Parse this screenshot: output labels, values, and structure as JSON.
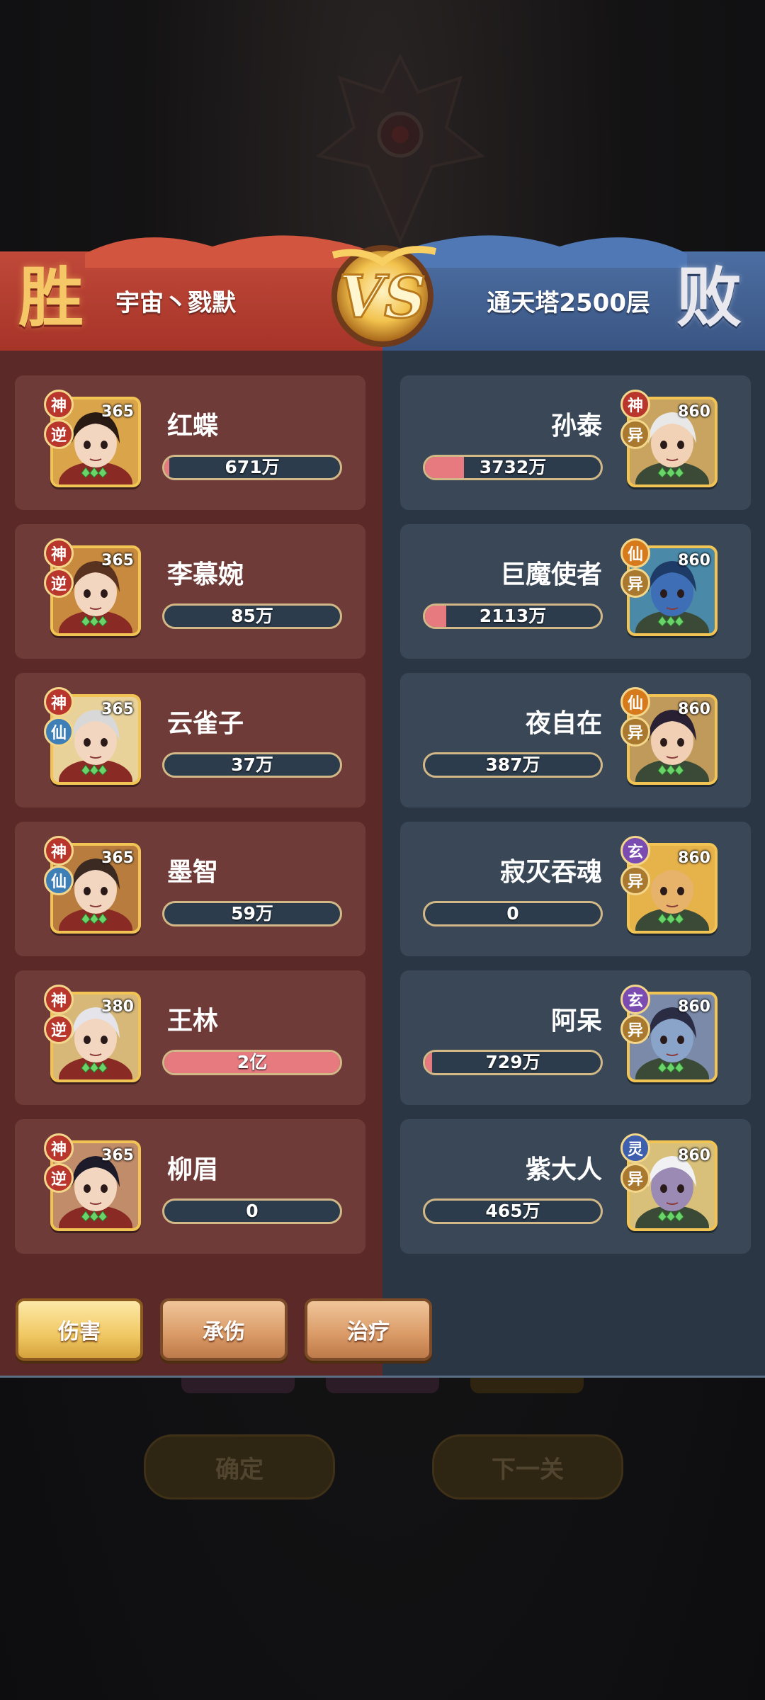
{
  "header": {
    "win_glyph": "胜",
    "lose_glyph": "败",
    "left_team": "宇宙丶戮默",
    "right_team": "通天塔2500层",
    "vs_label": "VS"
  },
  "left_heroes": [
    {
      "name": "红蝶",
      "level": "365",
      "badge_top": "神",
      "badge_bottom": "逆",
      "value": "671万",
      "fill": 0.03
    },
    {
      "name": "李慕婉",
      "level": "365",
      "badge_top": "神",
      "badge_bottom": "逆",
      "value": "85万",
      "fill": 0.0
    },
    {
      "name": "云雀子",
      "level": "365",
      "badge_top": "神",
      "badge_bottom": "仙",
      "value": "37万",
      "fill": 0.0
    },
    {
      "name": "墨智",
      "level": "365",
      "badge_top": "神",
      "badge_bottom": "仙",
      "value": "59万",
      "fill": 0.0
    },
    {
      "name": "王林",
      "level": "380",
      "badge_top": "神",
      "badge_bottom": "逆",
      "value": "2亿",
      "fill": 1.0
    },
    {
      "name": "柳眉",
      "level": "365",
      "badge_top": "神",
      "badge_bottom": "逆",
      "value": "0",
      "fill": 0.0
    }
  ],
  "right_heroes": [
    {
      "name": "孙泰",
      "level": "860",
      "badge_top": "神",
      "badge_bottom": "异",
      "value": "3732万",
      "fill": 0.22
    },
    {
      "name": "巨魔使者",
      "level": "860",
      "badge_top": "仙",
      "badge_bottom": "异",
      "value": "2113万",
      "fill": 0.12
    },
    {
      "name": "夜自在",
      "level": "860",
      "badge_top": "仙",
      "badge_bottom": "异",
      "value": "387万",
      "fill": 0.0
    },
    {
      "name": "寂灭吞魂",
      "level": "860",
      "badge_top": "玄",
      "badge_bottom": "异",
      "value": "0",
      "fill": 0.0
    },
    {
      "name": "阿呆",
      "level": "860",
      "badge_top": "玄",
      "badge_bottom": "异",
      "value": "729万",
      "fill": 0.04
    },
    {
      "name": "紫大人",
      "level": "860",
      "badge_top": "灵",
      "badge_bottom": "异",
      "value": "465万",
      "fill": 0.0
    }
  ],
  "tabs": {
    "damage": "伤害",
    "taken": "承伤",
    "heal": "治疗"
  },
  "bottom_buttons": {
    "confirm": "确定",
    "next": "下一关"
  },
  "colors": {
    "badge_shen": "#b8362c",
    "badge_ni": "#b8362c",
    "badge_xian_blue": "#3f7fb8",
    "badge_xian_orange": "#d67a1c",
    "badge_yi": "#a8792e",
    "badge_xuan": "#7a4bb0",
    "badge_ling": "#3e5fae",
    "bar_fill": "#e77a7f"
  }
}
